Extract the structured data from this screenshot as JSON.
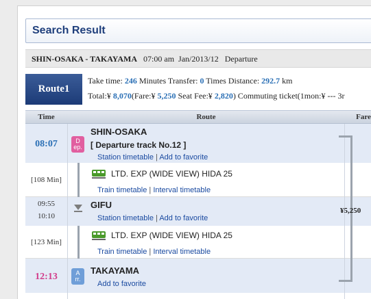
{
  "header": {
    "title": "Search Result"
  },
  "route_info": {
    "from_to": "SHIN-OSAKA - TAKAYAMA",
    "time": "07:00 am",
    "date": "Jan/2013/12",
    "mode": "Departure"
  },
  "route": {
    "badge": "Route1",
    "take_time_label": "Take time: ",
    "take_time_value": "246",
    "take_time_unit": " Minutes  Transfer: ",
    "transfer_value": "0",
    "transfer_unit": " Times  Distance: ",
    "distance_value": "292.7",
    "distance_unit": " km",
    "total_label": "Total:¥ ",
    "total_value": "8,070",
    "fare_label": "(Fare:¥ ",
    "fare_value": "5,250",
    "seat_label": "  Seat Fee:¥ ",
    "seat_value": "2,820",
    "seat_close": ")  Commuting ticket(1mon:¥ ---   3r"
  },
  "table": {
    "headers": {
      "time": "Time",
      "route": "Route",
      "fare": "Fare"
    },
    "rows": {
      "dep": {
        "time": "08:07",
        "icon_top": "D",
        "icon_bottom": "ep.",
        "station": "SHIN-OSAKA",
        "track": "[ Departure track No.12 ]",
        "link1": "Station timetable",
        "link2": "Add to favorite"
      },
      "ride1": {
        "duration": "[108 Min]",
        "train": "LTD. EXP (WIDE VIEW) HIDA 25",
        "link1": "Train timetable",
        "link2": "Interval timetable"
      },
      "transfer": {
        "arr_time": "09:55",
        "dep_time": "10:10",
        "station": "GIFU",
        "link1": "Station timetable",
        "link2": "Add to favorite"
      },
      "ride2": {
        "duration": "[123 Min]",
        "train": "LTD. EXP (WIDE VIEW) HIDA 25",
        "link1": "Train timetable",
        "link2": "Interval timetable"
      },
      "arr": {
        "time": "12:13",
        "icon_top": "A",
        "icon_bottom": "rr.",
        "station": "TAKAYAMA",
        "link1": "Add to favorite"
      }
    },
    "fare": "¥5,250"
  },
  "colors": {
    "accent_blue": "#2a6fb5",
    "arrival_pink": "#d23b8a",
    "departure_icon": "#e15fa0",
    "arrival_icon": "#6f9ed8",
    "train_green": "#4a9a2a"
  }
}
